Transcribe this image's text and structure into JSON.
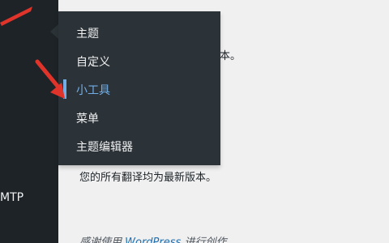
{
  "sidebar": {
    "partial_item_label": "MTP"
  },
  "flyout": {
    "items": [
      {
        "label": "主题",
        "active": false
      },
      {
        "label": "自定义",
        "active": false
      },
      {
        "label": "小工具",
        "active": true
      },
      {
        "label": "菜单",
        "active": false
      },
      {
        "label": "主题编辑器",
        "active": false
      }
    ]
  },
  "content": {
    "partial_line": "版本。",
    "translations_status": "您的所有翻译均为最新版本。",
    "footer_prefix": "感谢使用",
    "footer_link": "WordPress",
    "footer_suffix": "进行创作"
  },
  "colors": {
    "sidebar_bg": "#1d2327",
    "flyout_bg": "#2c3338",
    "active": "#72aee6",
    "annotation_red": "#e0342b"
  }
}
